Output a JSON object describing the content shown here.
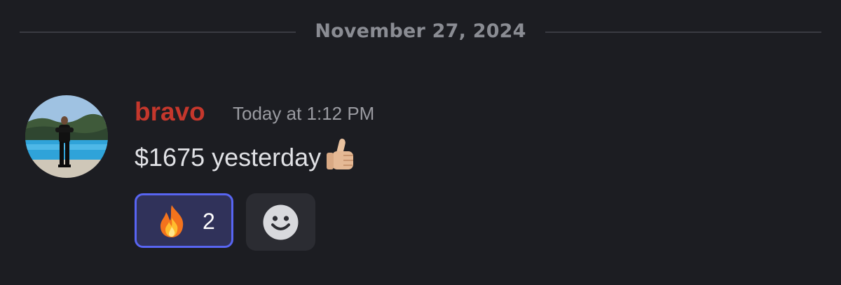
{
  "divider": {
    "date": "November 27, 2024"
  },
  "message": {
    "author": "bravo",
    "author_color": "#c5372c",
    "timestamp": "Today at 1:12 PM",
    "text": "$1675 yesterday",
    "emoji": "thumbs-up-light-skin-tone",
    "avatar": "profile-photo"
  },
  "reactions": [
    {
      "emoji": "fire",
      "count": "2",
      "active": true
    }
  ],
  "add_reaction": {
    "icon": "smiley-icon"
  },
  "colors": {
    "background": "#1c1d22",
    "reaction_border": "#5865f2",
    "reaction_bg": "#30325a"
  }
}
